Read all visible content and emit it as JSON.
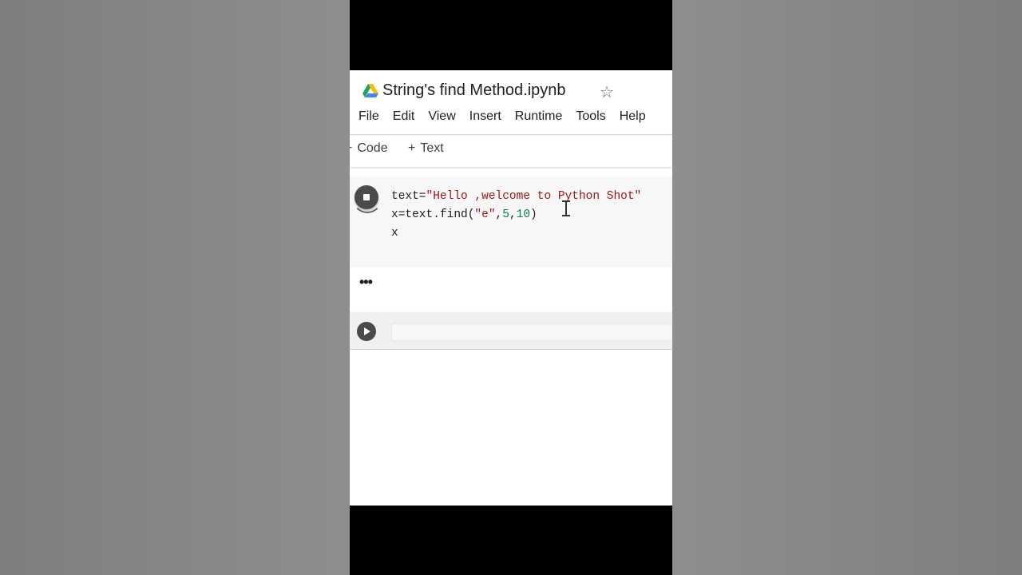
{
  "notebook": {
    "title": "String's find Method.ipynb",
    "menu": [
      "File",
      "Edit",
      "View",
      "Insert",
      "Runtime",
      "Tools",
      "Help"
    ]
  },
  "toolbar": {
    "code_label": "Code",
    "text_label": "Text",
    "plus": "+"
  },
  "cell": {
    "line1_var": "text=",
    "line1_str": "\"Hello ,welcome to Python Shot\"",
    "line2_pre": "x=text.find(",
    "line2_str": "\"e\"",
    "line2_comma1": ",",
    "line2_num1": "5",
    "line2_comma2": ",",
    "line2_num2": "10",
    "line2_post": ")",
    "line3": "x"
  },
  "output": {
    "ellipsis": "•••"
  },
  "colors": {
    "string": "#a31515",
    "number": "#098658",
    "button": "#4a4a4a"
  },
  "icons": {
    "drive": "google-drive-icon",
    "star": "star-icon",
    "stop": "stop-icon",
    "play": "play-icon"
  }
}
